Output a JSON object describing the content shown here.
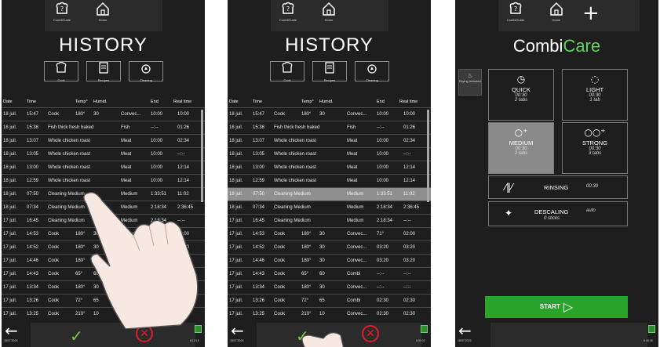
{
  "nav": {
    "combiguide_label": "CombiGuide",
    "home_label": "Home"
  },
  "history": {
    "title": "HISTORY",
    "categories": [
      {
        "label": "Cook",
        "icon": "chef-hat-icon"
      },
      {
        "label": "Recipes",
        "icon": "recipe-book-icon"
      },
      {
        "label": "Cleaning",
        "icon": "cleaning-drop-icon"
      }
    ],
    "columns": [
      "Date",
      "Time",
      "Temp°",
      "Humid.",
      "End",
      "Real time"
    ],
    "rows": [
      {
        "date": "18 juil.",
        "time": "15:47",
        "name": "Cook",
        "temp": "180°",
        "humid": "30",
        "mode": "Convec...",
        "end": "10:00",
        "real": "10:00"
      },
      {
        "date": "18 juil.",
        "time": "15:38",
        "name": "Fish thick fresh baked",
        "temp": "",
        "humid": "",
        "mode": "Fish",
        "end": "--:--",
        "real": "01:26"
      },
      {
        "date": "18 juil.",
        "time": "13:07",
        "name": "Whole chicken roast",
        "temp": "",
        "humid": "",
        "mode": "Meat",
        "end": "10:00",
        "real": "02:34"
      },
      {
        "date": "18 juil.",
        "time": "13:05",
        "name": "Whole chicken roast",
        "temp": "",
        "humid": "",
        "mode": "Meat",
        "end": "10:00",
        "real": "--:--"
      },
      {
        "date": "18 juil.",
        "time": "13:00",
        "name": "Whole chicken roast",
        "temp": "",
        "humid": "",
        "mode": "Meat",
        "end": "10:00",
        "real": "12:14"
      },
      {
        "date": "18 juil.",
        "time": "12:59",
        "name": "Whole chicken roast",
        "temp": "",
        "humid": "",
        "mode": "Meat",
        "end": "10:00",
        "real": "12:14"
      },
      {
        "date": "18 juil.",
        "time": "07:50",
        "name": "Cleaning Medium",
        "temp": "",
        "humid": "",
        "mode": "Medium",
        "end": "1:33:51",
        "real": "11:02"
      },
      {
        "date": "18 juil.",
        "time": "07:34",
        "name": "Cleaning Medium",
        "temp": "",
        "humid": "",
        "mode": "Medium",
        "end": "2:18:34",
        "real": "2:36:45"
      },
      {
        "date": "17 juil.",
        "time": "16:45",
        "name": "Cleaning Medium",
        "temp": "",
        "humid": "",
        "mode": "Medium",
        "end": "2:18:34",
        "real": "--:--"
      },
      {
        "date": "17 juil.",
        "time": "14:53",
        "name": "Cook",
        "temp": "180°",
        "humid": "30",
        "mode": "Convec...",
        "end": "71°",
        "real": "02:00"
      },
      {
        "date": "17 juil.",
        "time": "14:52",
        "name": "Cook",
        "temp": "180°",
        "humid": "30",
        "mode": "Convec...",
        "end": "03:20",
        "real": "03:20"
      },
      {
        "date": "17 juil.",
        "time": "14:46",
        "name": "Cook",
        "temp": "180°",
        "humid": "30",
        "mode": "Convec...",
        "end": "03:20",
        "real": "03:20"
      },
      {
        "date": "17 juil.",
        "time": "14:43",
        "name": "Cook",
        "temp": "65°",
        "humid": "60",
        "mode": "Combi",
        "end": "--:--",
        "real": "--:--"
      },
      {
        "date": "17 juil.",
        "time": "13:34",
        "name": "Cook",
        "temp": "180°",
        "humid": "30",
        "mode": "Convec...",
        "end": "--:--",
        "real": "--:--"
      },
      {
        "date": "17 juil.",
        "time": "13:26",
        "name": "Cook",
        "temp": "72°",
        "humid": "65",
        "mode": "Combi",
        "end": "02:30",
        "real": "02:30"
      },
      {
        "date": "17 juil.",
        "time": "13:25",
        "name": "Cook",
        "temp": "210°",
        "humid": "10",
        "mode": "Convec...",
        "end": "02:30",
        "real": "02:30"
      }
    ],
    "selected_row": 6
  },
  "footer": {
    "date": "18/07/2024",
    "time_1": "6:12:18",
    "time_2": "6:30:02",
    "time_3": "6:46:48"
  },
  "combicare": {
    "title_part1": "Combi",
    "title_part2": "Care",
    "drying_label": "Drying included",
    "programs": [
      {
        "name": "QUICK",
        "duration": "00:30",
        "tabs": "2 tabs",
        "selected": false
      },
      {
        "name": "LIGHT",
        "duration": "00:30",
        "tabs": "1 tab",
        "selected": false
      },
      {
        "name": "MEDIUM",
        "duration": "00:30",
        "tabs": "2 tabs",
        "selected": true
      },
      {
        "name": "STRONG",
        "duration": "00:30",
        "tabs": "3 tabs",
        "selected": false
      }
    ],
    "rinsing_label": "RINSING",
    "rinsing_value": "00:30",
    "descaling_label": "DESCALING",
    "descaling_value": "auto",
    "descaling_sticks": "0 sticks",
    "start_label": "START"
  },
  "colors": {
    "accent_green": "#29a329",
    "care_green": "#5fd35f",
    "cancel_red": "#e21b2b",
    "selected_grey": "#8a8a8a",
    "screen_bg": "#1e1e1e"
  }
}
